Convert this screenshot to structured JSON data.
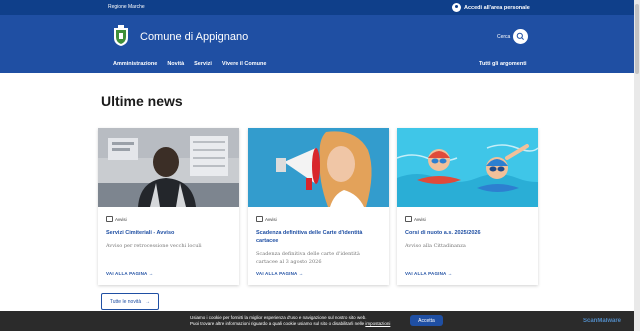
{
  "topbar": {
    "region": "Regione Marche",
    "login": "Accedi all'area personale"
  },
  "header": {
    "site_name": "Comune di Appignano",
    "search_label": "Cerca",
    "nav": [
      "Amministrazione",
      "Novità",
      "Servizi",
      "Vivere il Comune"
    ],
    "nav_right": "Tutti gli argomenti"
  },
  "section": {
    "title": "Ultime news"
  },
  "cards": [
    {
      "category": "Avvisi",
      "title": "Servizi Cimiteriali - Avviso",
      "description": "Avviso per retrocessione vecchi loculi",
      "more": "VAI ALLA PAGINA"
    },
    {
      "category": "Avvisi",
      "title": "Scadenza definitiva delle Carte d'identità cartacee",
      "description": "Scadenza definitiva delle carte d'identità cartacee al 3 agosto 2026",
      "more": "VAI ALLA PAGINA"
    },
    {
      "category": "Avvisi",
      "title": "Corsi di nuoto a.s. 2025/2026",
      "description": "Avviso alla Cittadinanza",
      "more": "VAI ALLA PAGINA"
    }
  ],
  "all_news": "Tutte le novità",
  "cookie": {
    "line1": "Usiamo i cookie per fornirti la miglior esperienza d'uso e navigazione sul nostro sito web.",
    "line2": "Puoi trovare altre informazioni riguardo a quali cookie usiamo sul sito o disabilitarli nelle ",
    "link": "impostazioni",
    "accept": "Accetta"
  },
  "watermark": "ScanMalware",
  "colors": {
    "primary": "#1f4fa3",
    "topbar": "#0f3f8a",
    "cookie_bg": "#2b2b2b"
  }
}
